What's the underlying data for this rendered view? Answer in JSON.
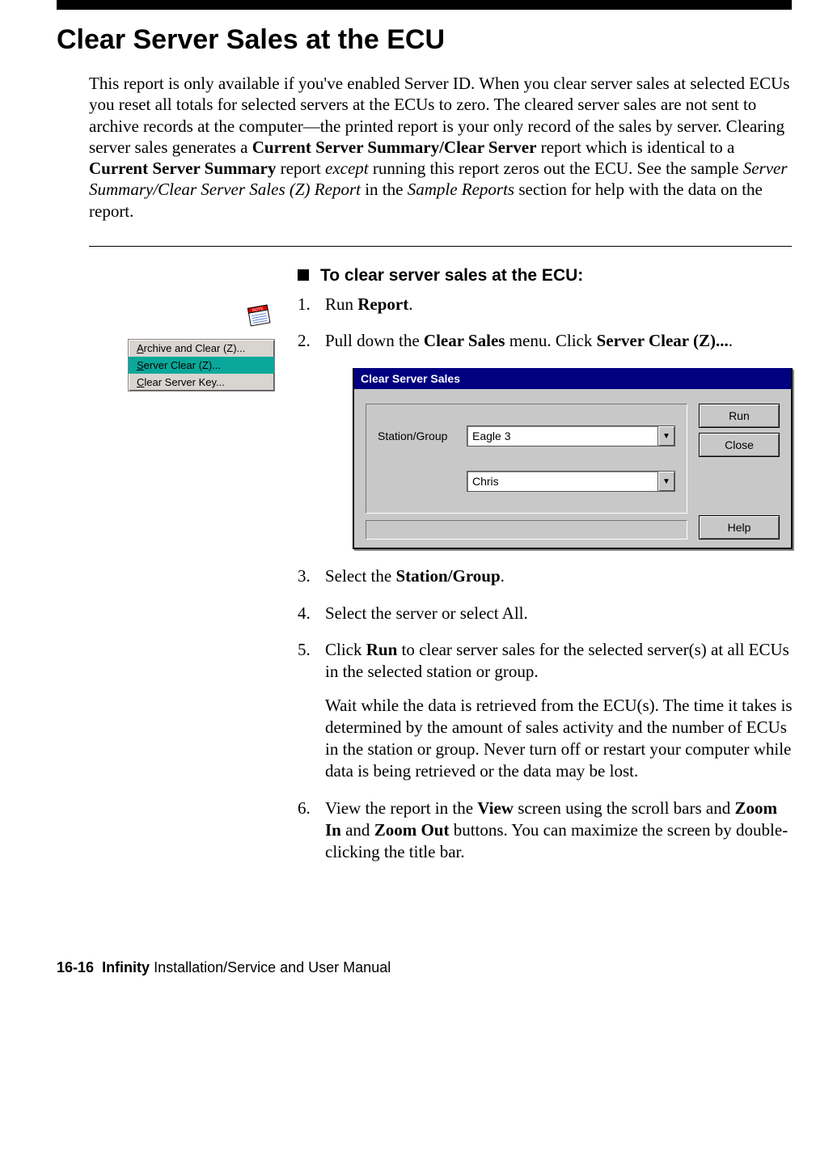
{
  "title": "Clear Server Sales at the ECU",
  "intro": {
    "t1": "This report is only available if you've enabled  Server ID. When you clear server sales at selected ECUs you reset all totals for selected servers at the ECUs to zero. The cleared server sales are not sent to archive records at the computer—the printed report is your only record of the sales by server. Clearing server sales generates a ",
    "b1": "Current Server Summary/Clear Server",
    "t2": " report which is identical to a ",
    "b2": "Current Server Summary",
    "t3": " report ",
    "i1": "except",
    "t4": " running this report zeros out the ECU. See the sample ",
    "i2": "Server Summary/Clear Server Sales (Z) Report",
    "t5": " in the ",
    "i3": "Sample Reports",
    "t6": " section for help with the data on the report."
  },
  "menu": {
    "item1_pre": "A",
    "item1_rest": "rchive and Clear (Z)...",
    "item2_pre": "S",
    "item2_rest": "erver Clear (Z)...",
    "item3_pre": "C",
    "item3_rest": "lear Server Key..."
  },
  "proc_heading": "To clear server sales at the ECU:",
  "steps": {
    "s1a": "Run ",
    "s1b": "Report",
    "s1c": ".",
    "s2a": "Pull down the ",
    "s2b": "Clear Sales",
    "s2c": " menu. Click ",
    "s2d": "Server Clear (Z)...",
    "s2e": ".",
    "s3a": "Select the ",
    "s3b": "Station/Group",
    "s3c": ".",
    "s4": "Select the server or select All.",
    "s5a": "Click ",
    "s5b": "Run",
    "s5c": " to clear server sales for the selected server(s) at all ECUs in the selected station or group.",
    "s5note": "Wait while the data is retrieved from the ECU(s). The time it takes is determined by the amount of sales activity and the number of ECUs in the station or group. Never turn off or restart your computer while data is being retrieved or the data may be lost.",
    "s6a": "View the report in the ",
    "s6b": "View",
    "s6c": " screen using the scroll bars and ",
    "s6d": "Zoom In",
    "s6e": " and ",
    "s6f": "Zoom Out",
    "s6g": " buttons. You can maximize the screen by double-clicking the title bar."
  },
  "dialog": {
    "title": "Clear Server Sales",
    "label1": "Station/Group",
    "combo1": "Eagle 3",
    "combo2": "Chris",
    "btn_run": "Run",
    "btn_close": "Close",
    "btn_help": "Help"
  },
  "footer": {
    "pg": "16-16",
    "bold": "Infinity",
    "rest": " Installation/Service and User Manual"
  }
}
